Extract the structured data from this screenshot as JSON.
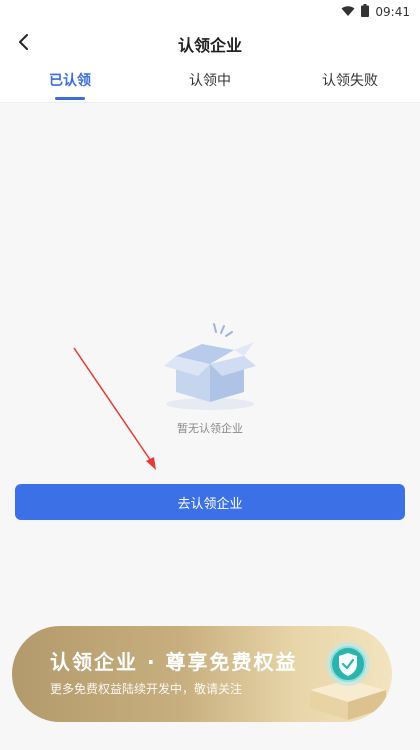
{
  "status_bar": {
    "time": "09:41",
    "icons": [
      "wifi-icon",
      "battery-icon"
    ]
  },
  "nav": {
    "title": "认领企业",
    "back_icon": "chevron-left-icon"
  },
  "tabs": [
    {
      "label": "已认领",
      "active": true
    },
    {
      "label": "认领中",
      "active": false
    },
    {
      "label": "认领失败",
      "active": false
    }
  ],
  "empty_state": {
    "icon": "empty-box-icon",
    "text": "暂无认领企业"
  },
  "primary_button": {
    "label": "去认领企业"
  },
  "promo_banner": {
    "title": "认领企业 · 尊享免费权益",
    "subtitle": "更多免费权益陆续开发中，敬请关注",
    "icon": "shield-check-icon"
  },
  "colors": {
    "accent": "#3a6fd8",
    "button": "#3c70e6",
    "annotation_arrow": "#e53935",
    "banner_gold": "#c8af7f"
  }
}
